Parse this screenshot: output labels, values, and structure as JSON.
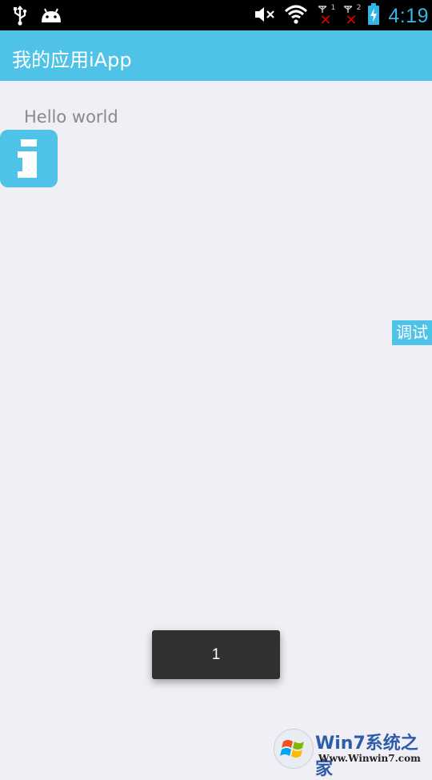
{
  "status_bar": {
    "time": "4:19",
    "sim1_label": "1",
    "sim2_label": "2",
    "icons": [
      "usb-icon",
      "android-icon",
      "mute-icon",
      "wifi-icon",
      "sim1-no-signal-icon",
      "sim2-no-signal-icon",
      "battery-charging-icon"
    ]
  },
  "action_bar": {
    "title": "我的应用iApp"
  },
  "content": {
    "text": "Hello world"
  },
  "debug_button": {
    "label": "调试"
  },
  "toast": {
    "text": "1"
  },
  "watermark": {
    "title": "Win7系统之家",
    "url": "Www.Winwin7.com"
  },
  "colors": {
    "accent": "#4fc3e7",
    "background": "#efeff5",
    "clock": "#33b5e5"
  }
}
